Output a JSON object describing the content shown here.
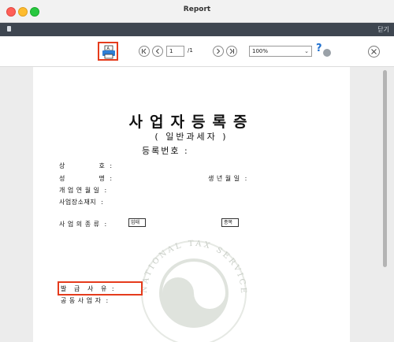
{
  "window": {
    "title": "Report"
  },
  "darkbar": {
    "right_text": "닫기"
  },
  "toolbar": {
    "page_current": "1",
    "page_total": "/1",
    "zoom": "100%",
    "help_label": "?"
  },
  "document": {
    "title": "사업자등록증",
    "subtitle": "( 일반과세자 )",
    "reg_label": "등록번호 :",
    "fields": {
      "shop": "상              호  :",
      "name": "성              명  :",
      "birth": "생 년 월 일  :",
      "open_date": "개 업 연 월 일  :",
      "location": "사업장소재지  :",
      "biz_type": "사 업 의 종 류  :",
      "biz_type_box1": "업태",
      "biz_type_box2": "종목",
      "issue_reason": "발   급   사   유  :",
      "joint_owner": "공 동 사 업 자  :"
    },
    "seal_text": "NATIONAL TAX SERVICE REPUBLIC OF KOREA"
  },
  "colors": {
    "highlight": "#e53b1c",
    "darkbar": "#3e4650",
    "seal": "#dfe3dd"
  }
}
